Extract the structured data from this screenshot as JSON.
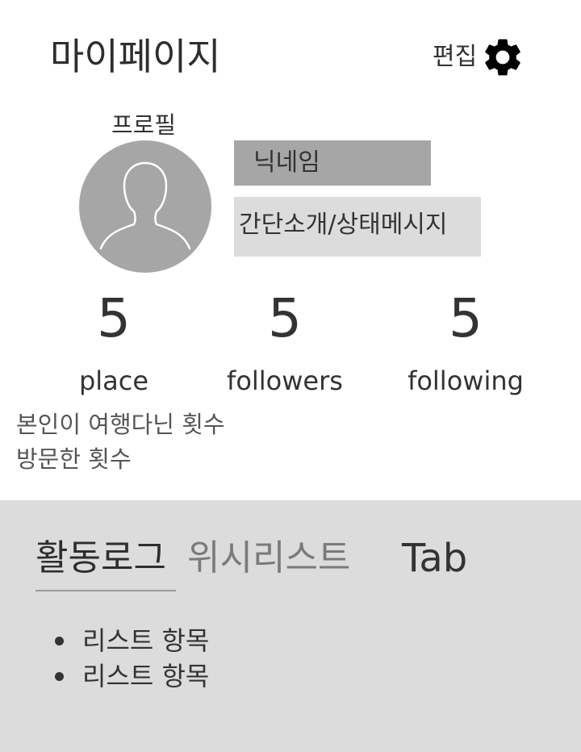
{
  "header": {
    "title": "마이페이지",
    "edit_label": "편집"
  },
  "profile": {
    "section_label": "프로필",
    "nickname": "닉네임",
    "status_message": "간단소개/상태메시지"
  },
  "stats": [
    {
      "value": "5",
      "label": "place"
    },
    {
      "value": "5",
      "label": "followers"
    },
    {
      "value": "5",
      "label": "following"
    }
  ],
  "notes": [
    "본인이 여행다닌 횟수",
    "방문한 횟수"
  ],
  "tabs": [
    {
      "label": "활동로그",
      "active": true
    },
    {
      "label": "위시리스트",
      "active": false
    },
    {
      "label": "Tab",
      "active": false
    }
  ],
  "list_items": [
    "리스트 항목",
    "리스트 항목"
  ],
  "icons": {
    "settings": "gear-icon",
    "avatar": "person-silhouette-icon"
  },
  "colors": {
    "avatar_bg": "#a6a6a6",
    "nickname_bg": "#a6a6a6",
    "status_bg": "#dcdcdc",
    "lower_bg": "#dcdcdc"
  }
}
